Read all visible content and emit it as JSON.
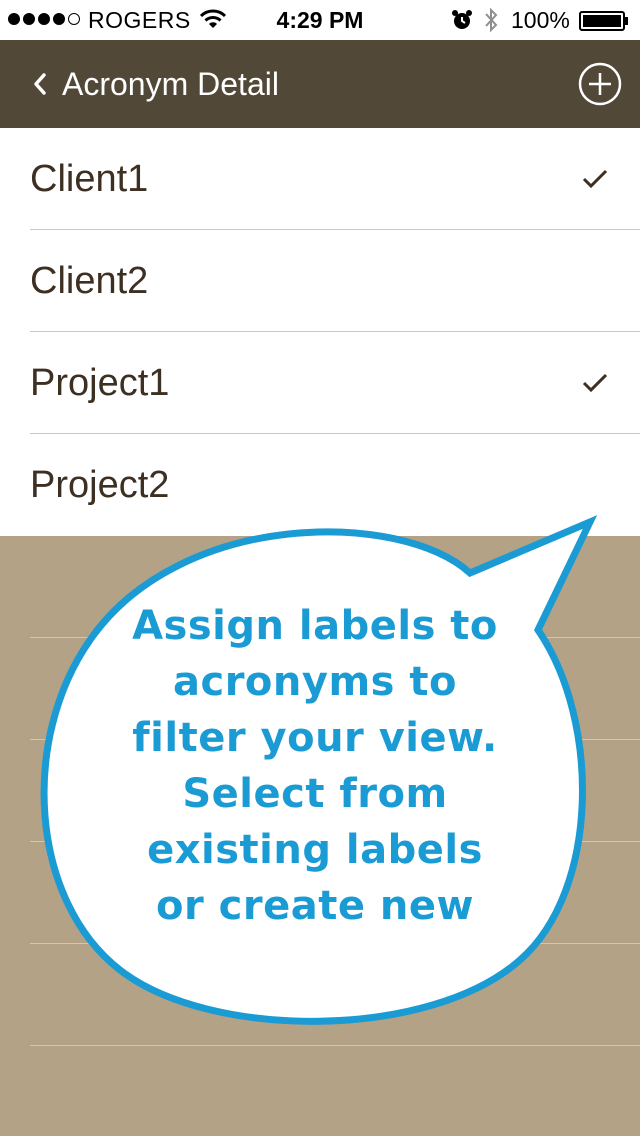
{
  "status_bar": {
    "carrier": "ROGERS",
    "time": "4:29 PM",
    "battery_percent": "100%",
    "signal_bars_filled": 4,
    "signal_bars_total": 5
  },
  "nav": {
    "back_label": "Acronym Detail",
    "add_icon": "plus-circle-icon"
  },
  "labels": [
    {
      "name": "Client1",
      "checked": true
    },
    {
      "name": "Client2",
      "checked": false
    },
    {
      "name": "Project1",
      "checked": true
    },
    {
      "name": "Project2",
      "checked": false
    }
  ],
  "tooltip": {
    "lines": [
      "Assign labels to",
      "acronyms to",
      "filter your view.",
      "Select from",
      "existing labels",
      "or create new"
    ]
  },
  "colors": {
    "nav_background": "#524838",
    "background": "#b4a287",
    "row_text": "#3d2f22",
    "bubble_accent": "#1a9bd4"
  }
}
